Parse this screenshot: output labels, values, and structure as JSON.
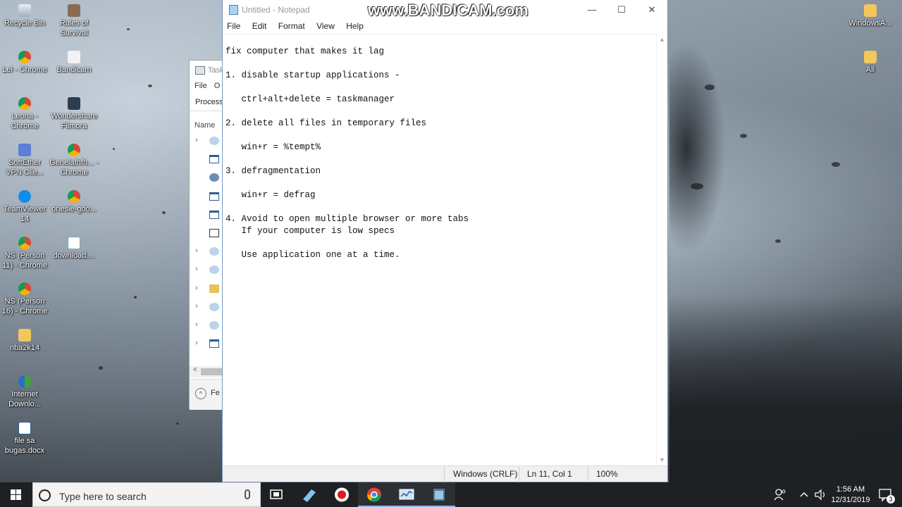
{
  "desktop": {
    "icons_left": [
      {
        "label": "Recycle Bin",
        "icon": "recycle-bin-icon"
      },
      {
        "label": "Rules of Survival",
        "icon": "game-icon"
      },
      {
        "label": "Lei - Chrome",
        "icon": "chrome-icon"
      },
      {
        "label": "Bandicam",
        "icon": "bandicam-icon"
      },
      {
        "label": "Leona - Chrome",
        "icon": "chrome-icon"
      },
      {
        "label": "Wondershare Filmora",
        "icon": "filmora-icon"
      },
      {
        "label": "SoftEther VPN Clie...",
        "icon": "vpn-icon"
      },
      {
        "label": "Genelafhfh... - Chrome",
        "icon": "chrome-icon"
      },
      {
        "label": "TeamViewer 14",
        "icon": "teamviewer-icon"
      },
      {
        "label": "onesie-goo...",
        "icon": "chrome-icon"
      },
      {
        "label": "NS (Person 11) - Chrome",
        "icon": "chrome-icon"
      },
      {
        "label": "download....",
        "icon": "file-icon"
      },
      {
        "label": "NS (Person 16) - Chrome",
        "icon": "chrome-icon"
      },
      {
        "label": "nba2k14",
        "icon": "folder-icon"
      },
      {
        "label": "Internet Downlo...",
        "icon": "idm-icon"
      },
      {
        "label": "file sa bugas.docx",
        "icon": "word-doc-icon"
      }
    ],
    "icons_right": [
      {
        "label": "WindowsA...",
        "icon": "folder-icon"
      },
      {
        "label": "All",
        "icon": "folder-icon"
      }
    ]
  },
  "task_manager": {
    "title": "Task",
    "menu": [
      "File",
      "O"
    ],
    "tab": "Process",
    "column_header": "Name",
    "footer": "Fe",
    "scroll_left": "<"
  },
  "notepad": {
    "title": "Untitled - Notepad",
    "watermark": "www.BANDICAM.com",
    "window_buttons": {
      "minimize": "—",
      "maximize": "☐",
      "close": "✕"
    },
    "menu": [
      "File",
      "Edit",
      "Format",
      "View",
      "Help"
    ],
    "lines": [
      "fix computer that makes it lag",
      "",
      "1. disable startup applications -",
      "",
      "   ctrl+alt+delete = taskmanager",
      "",
      "2. delete all files in temporary files",
      "",
      "   win+r = %tempt%",
      "",
      "3. defragmentation",
      "",
      "   win+r = defrag",
      "",
      "4. Avoid to open multiple browser or more tabs",
      "   If your computer is low specs",
      "",
      "   Use application one at a time."
    ],
    "status": {
      "line_ending": "Windows (CRLF)",
      "position": "Ln 11, Col 1",
      "zoom": "100%"
    }
  },
  "taskbar": {
    "search_placeholder": "Type here to search",
    "clock_time": "1:56 AM",
    "clock_date": "12/31/2019",
    "notification_count": "3"
  }
}
